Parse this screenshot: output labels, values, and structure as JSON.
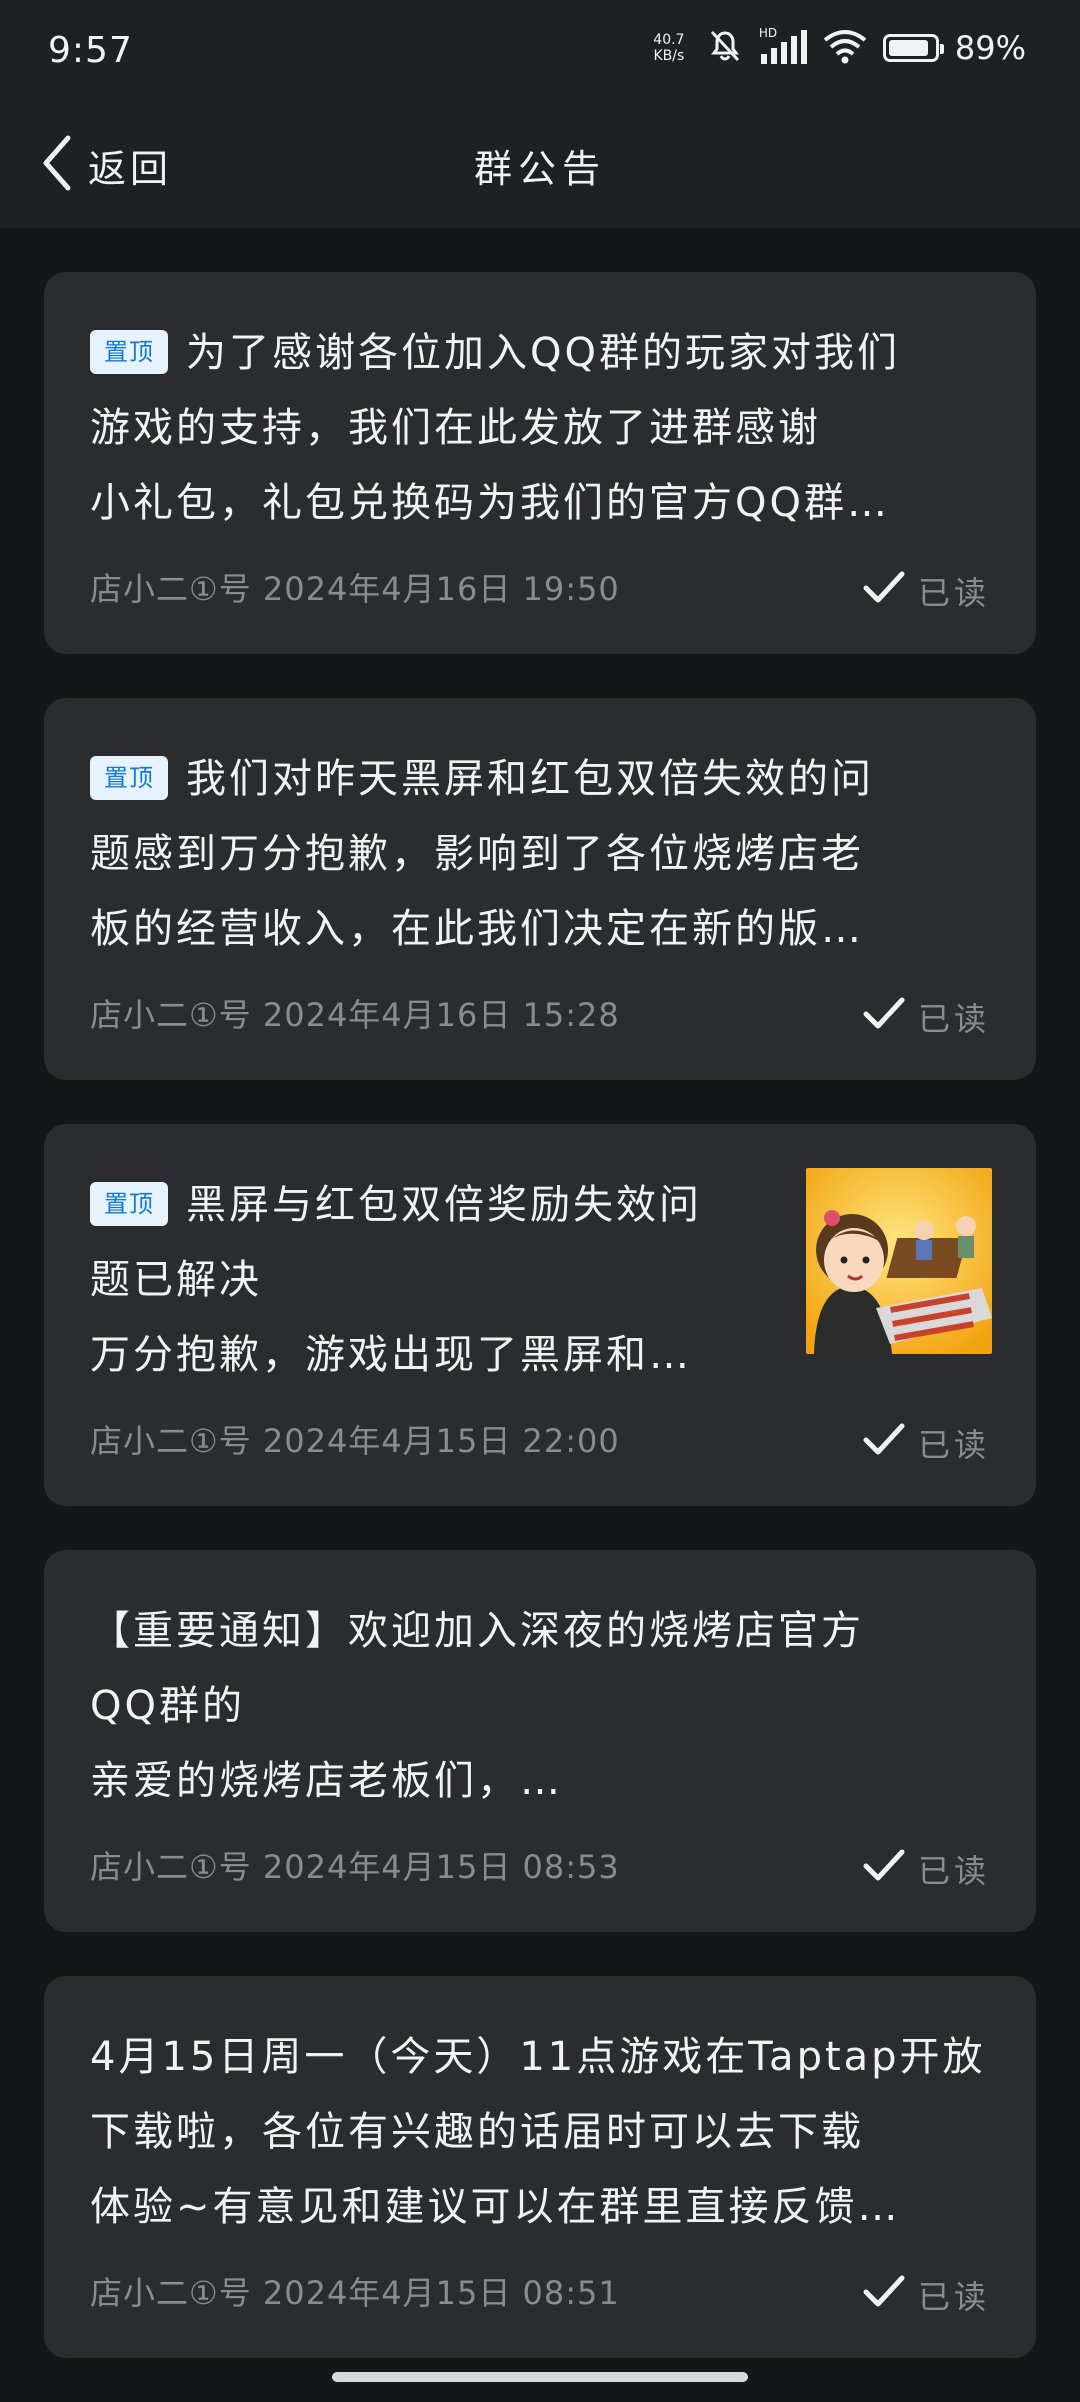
{
  "status_bar": {
    "time": "9:57",
    "net_speed_value": "40.7",
    "net_speed_unit": "KB/s",
    "signal_label": "HD",
    "battery": "89%",
    "battery_level": 0.89
  },
  "header": {
    "back_label": "返回",
    "title": "群公告"
  },
  "announcements": [
    {
      "pinned": true,
      "pin_label": "置顶",
      "lines": [
        "为了感谢各位加入QQ群的玩家对我们",
        "游戏的支持，我们在此发放了进群感谢",
        "小礼包，礼包兑换码为我们的官方QQ群…"
      ],
      "meta": "店小二①号 2024年4月16日 19:50",
      "read_label": "已读"
    },
    {
      "pinned": true,
      "pin_label": "置顶",
      "lines": [
        "我们对昨天黑屏和红包双倍失效的问",
        "题感到万分抱歉，影响到了各位烧烤店老",
        "板的经营收入，在此我们决定在新的版…"
      ],
      "meta": "店小二①号 2024年4月16日 15:28",
      "read_label": "已读"
    },
    {
      "pinned": true,
      "pin_label": "置顶",
      "lines": [
        "黑屏与红包双倍奖励失效问",
        "题已解决",
        "万分抱歉，游戏出现了黑屏和…"
      ],
      "meta": "店小二①号 2024年4月15日 22:00",
      "read_label": "已读",
      "has_image": true
    },
    {
      "pinned": false,
      "lines": [
        "【重要通知】欢迎加入深夜的烧烤店官方",
        "QQ群的",
        "亲爱的烧烤店老板们，…"
      ],
      "meta": "店小二①号 2024年4月15日 08:53",
      "read_label": "已读"
    },
    {
      "pinned": false,
      "lines": [
        "4月15日周一（今天）11点游戏在Taptap开放",
        "下载啦，各位有兴趣的话届时可以去下载",
        "体验~有意见和建议可以在群里直接反馈…"
      ],
      "meta": "店小二①号 2024年4月15日 08:51",
      "read_label": "已读"
    }
  ]
}
